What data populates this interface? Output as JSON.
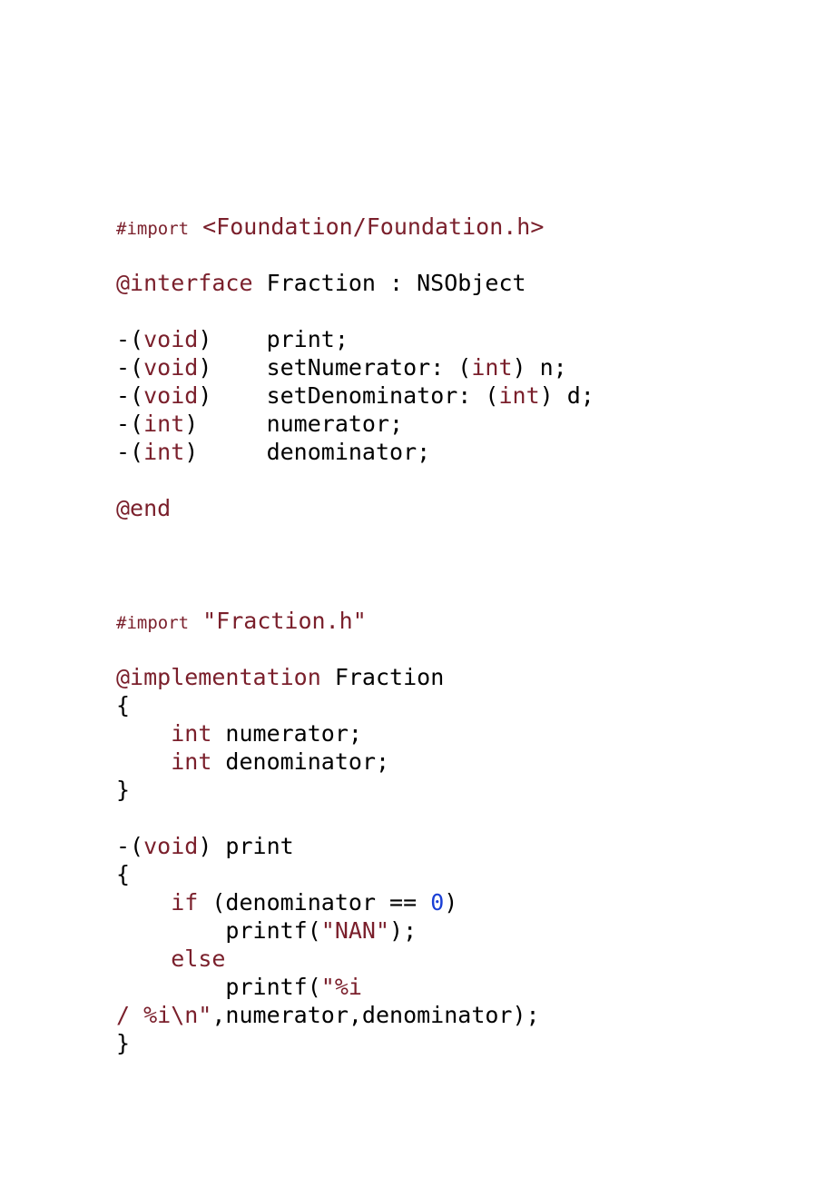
{
  "code": {
    "l01": {
      "a": "#import",
      "b": " <Foundation/Foundation.h>"
    },
    "l03": {
      "a": "@interface",
      "b": " Fraction : NSObject"
    },
    "l05": {
      "a": "-(",
      "b": "void",
      "c": ")    print;"
    },
    "l06": {
      "a": "-(",
      "b": "void",
      "c": ")    setNumerator: (",
      "d": "int",
      "e": ") n;"
    },
    "l07": {
      "a": "-(",
      "b": "void",
      "c": ")    setDenominator: (",
      "d": "int",
      "e": ") d;"
    },
    "l08": {
      "a": "-(",
      "b": "int",
      "c": ")     numerator;"
    },
    "l09": {
      "a": "-(",
      "b": "int",
      "c": ")     denominator;"
    },
    "l11": {
      "a": "@end"
    },
    "l15": {
      "a": "#import",
      "b": " \"Fraction.h\""
    },
    "l17": {
      "a": "@implementation",
      "b": " Fraction"
    },
    "l18": {
      "a": "{"
    },
    "l19": {
      "a": "    ",
      "b": "int",
      "c": " numerator;"
    },
    "l20": {
      "a": "    ",
      "b": "int",
      "c": " denominator;"
    },
    "l21": {
      "a": "}"
    },
    "l23": {
      "a": "-(",
      "b": "void",
      "c": ") print"
    },
    "l24": {
      "a": "{"
    },
    "l25": {
      "a": "    ",
      "b": "if",
      "c": " (denominator == ",
      "d": "0",
      "e": ")"
    },
    "l26": {
      "a": "        printf(",
      "b": "\"NAN\"",
      "c": ");"
    },
    "l27": {
      "a": "    ",
      "b": "else"
    },
    "l28": {
      "a": "        printf(",
      "b": "\"%i "
    },
    "l29": {
      "a": "/ %i\\n\"",
      "b": ",numerator,denominator);"
    },
    "l30": {
      "a": "}"
    }
  }
}
